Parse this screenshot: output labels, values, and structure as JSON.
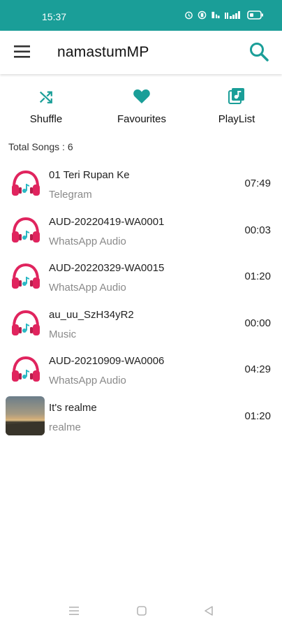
{
  "status_bar": {
    "time": "15:37",
    "icons": [
      "alarm-icon",
      "vibrate-icon",
      "data-icon",
      "signal-icon",
      "battery-icon"
    ],
    "background": "#1a9e98"
  },
  "app_bar": {
    "title": "namastumMP",
    "menu_icon": "menu-icon",
    "search_icon": "search-icon",
    "accent": "#1a9e98"
  },
  "actions": [
    {
      "label": "Shuffle",
      "icon": "shuffle-icon"
    },
    {
      "label": "Favourites",
      "icon": "heart-icon"
    },
    {
      "label": "PlayList",
      "icon": "playlist-icon"
    }
  ],
  "total_songs_label": "Total Songs : 6",
  "songs": [
    {
      "title": "01 Teri Rupan Ke",
      "album": "Telegram",
      "duration": "07:49",
      "thumb": "headphones-icon"
    },
    {
      "title": "AUD-20220419-WA0001",
      "album": "WhatsApp Audio",
      "duration": "00:03",
      "thumb": "headphones-icon"
    },
    {
      "title": "AUD-20220329-WA0015",
      "album": "WhatsApp Audio",
      "duration": "01:20",
      "thumb": "headphones-icon"
    },
    {
      "title": "au_uu_SzH34yR2",
      "album": "Music",
      "duration": "00:00",
      "thumb": "headphones-icon"
    },
    {
      "title": "AUD-20210909-WA0006",
      "album": "WhatsApp Audio",
      "duration": "04:29",
      "thumb": "headphones-icon"
    },
    {
      "title": "It's realme",
      "album": "realme",
      "duration": "01:20",
      "thumb": "album-art"
    }
  ],
  "nav_bar": {
    "buttons": [
      "recents-icon",
      "home-icon",
      "back-icon"
    ]
  }
}
